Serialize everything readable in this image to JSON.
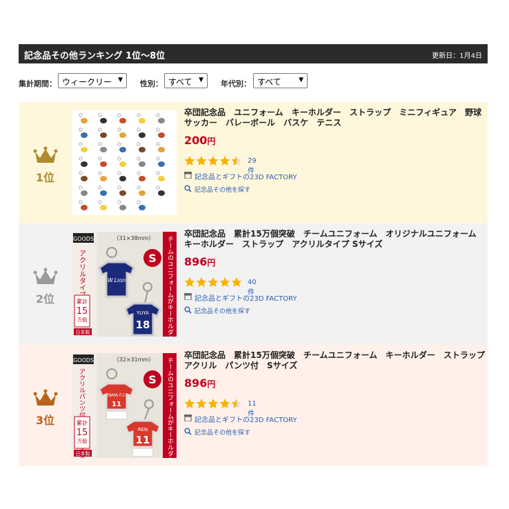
{
  "header": {
    "title": "記念品その他ランキング 1位～8位",
    "updated": "更新日：1月4日"
  },
  "filters": {
    "period_label": "集計期間：",
    "period_value": "ウィークリー",
    "gender_label": "性別：",
    "gender_value": "すべて",
    "age_label": "年代別：",
    "age_value": "すべて"
  },
  "items": [
    {
      "rank": "1位",
      "rank_color": "#b08a2c",
      "bg": "#fff7dc",
      "title": "卒団記念品　ユニフォーム　キーホルダー　ストラップ　ミニフィギュア　野球　サッカー　バレーボール　バスケ　テニス",
      "price": "200",
      "yen": "円",
      "rating": 4.5,
      "review_count": "29件",
      "shop": "記念品とギフトの23D FACTORY",
      "search": "記念品その他を探す"
    },
    {
      "rank": "2位",
      "rank_color": "#9a9a9a",
      "bg": "#f2f2f2",
      "title": "卒団記念品　累計15万個突破　チームユニフォーム　オリジナルユニフォーム　キーホルダー　ストラップ　アクリルタイプ Sサイズ",
      "price": "896",
      "yen": "円",
      "rating": 5,
      "review_count": "40件",
      "shop": "記念品とギフトの23D FACTORY",
      "search": "記念品その他を探す",
      "thumb": {
        "brand": "GOODS",
        "size": "（31×38mm）",
        "vertical_left": "アクリルタイプSサイズ",
        "vertical_right": "チームのユニフォームがキーホルダーに",
        "count_label": "累計",
        "count": "15",
        "count_unit": "万個",
        "made": "日本製",
        "badge": "S",
        "jersey_name": "YUYA",
        "jersey_number": "18",
        "jersey_team": "W.Lion"
      }
    },
    {
      "rank": "3位",
      "rank_color": "#b8651c",
      "bg": "#fff1ea",
      "title": "卒団記念品　累計15万個突破　チームユニフォーム　キーホルダー　ストラップ　アクリル　パンツ付　Sサイズ",
      "price": "896",
      "yen": "円",
      "rating": 4.5,
      "review_count": "11件",
      "shop": "記念品とギフトの23D FACTORY",
      "search": "記念品その他を探す",
      "thumb": {
        "brand": "GOODS",
        "size": "（32×31mm）",
        "vertical_left": "アクリルパンツ付タイプSサイズ",
        "vertical_right": "チームのユニフォームがキーホルダーに",
        "count_label": "累計",
        "count": "15",
        "count_unit": "万個",
        "made": "日本製",
        "badge": "S",
        "jersey_name": "REN",
        "jersey_number": "11",
        "jersey_team": "TAMA F.C.",
        "jersey_number_front": "11"
      }
    }
  ],
  "colors": {
    "header_bg": "#2b2b2b",
    "price": "#c0001f",
    "link": "#2a5db0",
    "star": "#f5b400"
  }
}
